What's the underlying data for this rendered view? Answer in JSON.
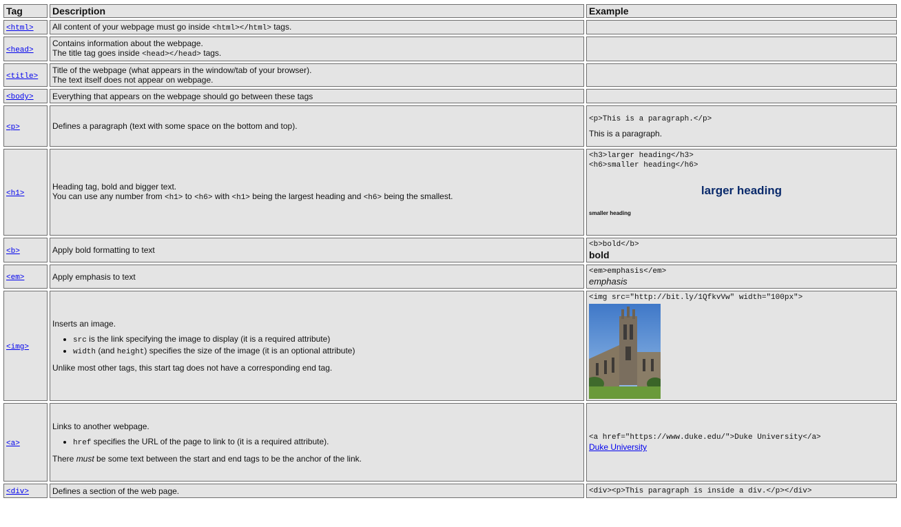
{
  "headers": {
    "tag": "Tag",
    "description": "Description",
    "example": "Example"
  },
  "rows": {
    "html": {
      "tag": "<html>",
      "desc": [
        "All content of your webpage must go inside ",
        "<html></html>",
        " tags."
      ]
    },
    "head": {
      "tag": "<head>",
      "desc1": "Contains information about the webpage.",
      "desc2": [
        "The title tag goes inside ",
        "<head></head>",
        " tags."
      ]
    },
    "title": {
      "tag": "<title>",
      "desc1": "Title of the webpage (what appears in the window/tab of your browser).",
      "desc2": "The text itself does not appear on webpage."
    },
    "body": {
      "tag": "<body>",
      "desc": "Everything that appears on the webpage should go between these tags"
    },
    "p": {
      "tag": "<p>",
      "desc": "Defines a paragraph (text with some space on the bottom and top).",
      "ex_code": "<p>This is a paragraph.</p>",
      "ex_render": "This is a paragraph."
    },
    "h1": {
      "tag": "<h1>",
      "desc1": "Heading tag, bold and bigger text.",
      "desc2": [
        "You can use any number from ",
        "<h1>",
        " to ",
        "<h6>",
        " with ",
        "<h1>",
        " being the largest heading and ",
        "<h6>",
        " being the smallest."
      ],
      "ex_code1": "<h3>larger heading</h3>",
      "ex_code2": "<h6>smaller heading</h6>",
      "ex_h3": "larger heading",
      "ex_h6": "smaller heading"
    },
    "b": {
      "tag": "<b>",
      "desc": "Apply bold formatting to text",
      "ex_code": "<b>bold</b>",
      "ex_render": "bold"
    },
    "em": {
      "tag": "<em>",
      "desc": "Apply emphasis to text",
      "ex_code": "<em>emphasis</em>",
      "ex_render": "emphasis"
    },
    "img": {
      "tag": "<img>",
      "desc1": "Inserts an image.",
      "bullet1": [
        "src",
        " is the link specifying the image to display (it is a required attribute)"
      ],
      "bullet2": [
        "width",
        " (and ",
        "height",
        ") specifies the size of the image (it is an optional attribute)"
      ],
      "desc3": "Unlike most other tags, this start tag does not have a corresponding end tag.",
      "ex_code": "<img src=\"http://bit.ly/1QfkvVw\" width=\"100px\">"
    },
    "a": {
      "tag": "<a>",
      "desc1": "Links to another webpage.",
      "bullet1": [
        "href",
        " specifies the URL of the page to link to (it is a required attribute)."
      ],
      "desc3": [
        "There ",
        "must",
        " be some text between the start and end tags to be the anchor of the link."
      ],
      "ex_code": "<a href=\"https://www.duke.edu/\">Duke University</a>",
      "ex_link": "Duke University"
    },
    "div": {
      "tag": "<div>",
      "desc": "Defines a section of the web page.",
      "ex_code": "<div><p>This paragraph is inside a div.</p></div>"
    }
  },
  "colors": {
    "cell_bg": "#e4e4e4",
    "border": "#6e6e6e",
    "link": "#0000ee",
    "h3_example": "#0a2a6b"
  }
}
